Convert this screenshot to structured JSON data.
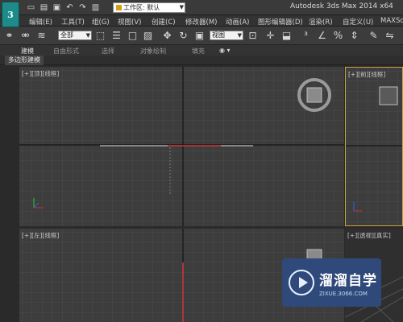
{
  "titlebar": {
    "logo_letter": "3",
    "workspace_label": "工作区: 默认",
    "title": "Autodesk 3ds Max  2014 x64"
  },
  "menubar": {
    "items": [
      "编辑(E)",
      "工具(T)",
      "组(G)",
      "视图(V)",
      "创建(C)",
      "修改器(M)",
      "动画(A)",
      "图形编辑器(D)",
      "渲染(R)",
      "自定义(U)",
      "MAXScr"
    ]
  },
  "toolbar": {
    "selection_filter": "全部",
    "ref_coord": "视图"
  },
  "ribbon": {
    "tabs": [
      "建模",
      "自由形式",
      "选择",
      "对象绘制",
      "填充"
    ],
    "active_tab": "建模",
    "sub_label": "多边形建模"
  },
  "viewports": {
    "top": "[+][顶][线框]",
    "front": "[+][前][线框]",
    "left": "[+][左][线框]",
    "perspective": "[+][透视][真实]"
  },
  "colors": {
    "active_viewport_border": "#c9a43a",
    "grid_bg": "#3d3d3d",
    "selected_object": "#d23a3a",
    "axis_x": "#c83232",
    "axis_y": "#32c832",
    "axis_z": "#3264dc"
  },
  "watermark": {
    "brand": "溜溜自学",
    "url": "ZIXUE.3066.COM"
  }
}
